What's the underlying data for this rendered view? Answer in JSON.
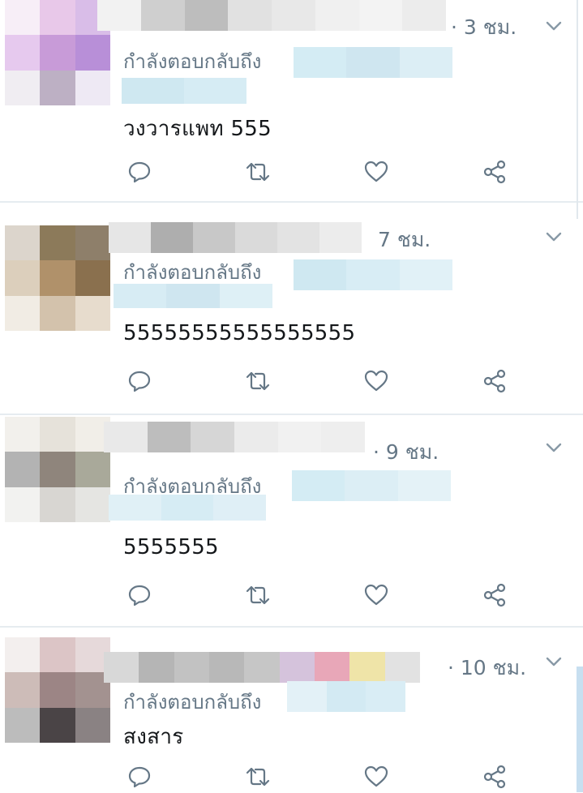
{
  "tweets": [
    {
      "time": "· 3 ชม.",
      "reply_prefix": "กำลังตอบกลับถึง",
      "text": "วงวารแพท 555",
      "avatar_colors": [
        "#f7eef7",
        "#e8c8e9",
        "#d9bde8",
        "#e6c9ee",
        "#c89bd8",
        "#b88fd8",
        "#f0edf2",
        "#bdb0c4",
        "#eee9f4"
      ]
    },
    {
      "time": "7 ชม.",
      "reply_prefix": "กำลังตอบกลับถึง",
      "text": "55555555555555555",
      "avatar_colors": [
        "#dcd5cc",
        "#8c7a5a",
        "#8e7f6a",
        "#dccfbc",
        "#b0916a",
        "#8a704e",
        "#f1ece4",
        "#d3c2ac",
        "#e7dccd"
      ]
    },
    {
      "time": "· 9 ชม.",
      "reply_prefix": "กำลังตอบกลับถึง",
      "text": "5555555",
      "avatar_colors": [
        "#f2f0ec",
        "#e6e2da",
        "#f1eee8",
        "#b3b3b3",
        "#8f857c",
        "#a9a99a",
        "#f2f2f0",
        "#d8d6d2",
        "#e5e5e2"
      ]
    },
    {
      "time": "· 10 ชม.",
      "reply_prefix": "กำลังตอบกลับถึง",
      "text": "สงสาร",
      "avatar_colors": [
        "#f3efee",
        "#dcc5c6",
        "#e6d9da",
        "#cdbcb8",
        "#9c8585",
        "#a39290",
        "#bcbcbc",
        "#4a4446",
        "#8a8283"
      ]
    }
  ],
  "icons": {
    "reply": "reply-icon",
    "retweet": "retweet-icon",
    "like": "heart-icon",
    "share": "share-icon",
    "more": "chevron-down-icon"
  },
  "colors": {
    "secondary_text": "#657786",
    "icon": "#657786",
    "mention_blur": "#cfe6f0",
    "divider": "#e6ecf0"
  }
}
